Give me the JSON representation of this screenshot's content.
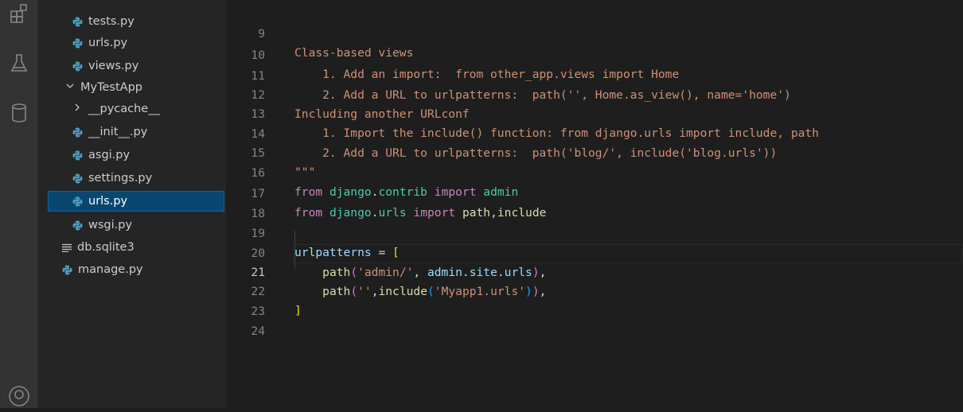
{
  "colors": {
    "activity_bar": "#333333",
    "sidebar": "#252526",
    "editor": "#1e1e1e",
    "selection": "#094771",
    "python_icon_blue": "#519aba",
    "string": "#ce9178",
    "keyword": "#c586c0",
    "module": "#4ec9b0",
    "function": "#dcdcaa",
    "variable": "#9cdcfe",
    "bracket": "#ffd700"
  },
  "activity_bar": {
    "icons": [
      "extensions-icon",
      "testing-flask-icon",
      "database-icon",
      "account-icon"
    ]
  },
  "explorer": {
    "items": [
      {
        "label": "tests.py",
        "icon": "python-file-icon"
      },
      {
        "label": "urls.py",
        "icon": "python-file-icon"
      },
      {
        "label": "views.py",
        "icon": "python-file-icon"
      },
      {
        "label": "MyTestApp",
        "icon": "chevron-down-icon"
      },
      {
        "label": "__pycache__",
        "icon": "chevron-right-icon"
      },
      {
        "label": "__init__.py",
        "icon": "python-file-icon"
      },
      {
        "label": "asgi.py",
        "icon": "python-file-icon"
      },
      {
        "label": "settings.py",
        "icon": "python-file-icon"
      },
      {
        "label": "urls.py",
        "icon": "python-file-icon",
        "selected": true
      },
      {
        "label": "wsgi.py",
        "icon": "python-file-icon"
      },
      {
        "label": "db.sqlite3",
        "icon": "text-file-icon"
      },
      {
        "label": "manage.py",
        "icon": "python-file-icon"
      }
    ]
  },
  "editor": {
    "current_line": "21",
    "line_numbers": [
      "9",
      "10",
      "11",
      "12",
      "13",
      "14",
      "15",
      "16",
      "17",
      "18",
      "19",
      "20",
      "21",
      "22",
      "23",
      "24"
    ],
    "lines": {
      "l9": "Class-based views",
      "l10": "    1. Add an import:  from other_app.views import Home",
      "l11": "    2. Add a URL to urlpatterns:  path('', Home.as_view(), name='home')",
      "l12": "Including another URLconf",
      "l13": "    1. Import the include() function: from django.urls import include, path",
      "l14": "    2. Add a URL to urlpatterns:  path('blog/', include('blog.urls'))",
      "l15": "\"\"\"",
      "l16": {
        "kw1": "from",
        "mod1": "django",
        "dot1": ".",
        "mod2": "contrib",
        "kw2": "import",
        "name": "admin"
      },
      "l17": {
        "kw1": "from",
        "mod1": "django",
        "dot1": ".",
        "mod2": "urls",
        "kw2": "import",
        "name1": "path",
        "comma": ",",
        "name2": "include"
      },
      "l19": {
        "var": "urlpatterns",
        "eq": " = ",
        "br": "["
      },
      "l20": {
        "indent": "    ",
        "fn": "path",
        "open": "(",
        "str": "'admin/'",
        "comma": ", ",
        "var1": "admin",
        "dot1": ".",
        "var2": "site",
        "dot2": ".",
        "var3": "urls",
        "close": ")",
        "tail": ","
      },
      "l21": {
        "indent": "    ",
        "fn": "path",
        "open": "(",
        "str1": "''",
        "comma": ",",
        "fn2": "include",
        "open2": "(",
        "str2": "'Myapp1.urls'",
        "close2": ")",
        "close": ")",
        "tail": ","
      },
      "l22": {
        "br": "]"
      }
    }
  }
}
